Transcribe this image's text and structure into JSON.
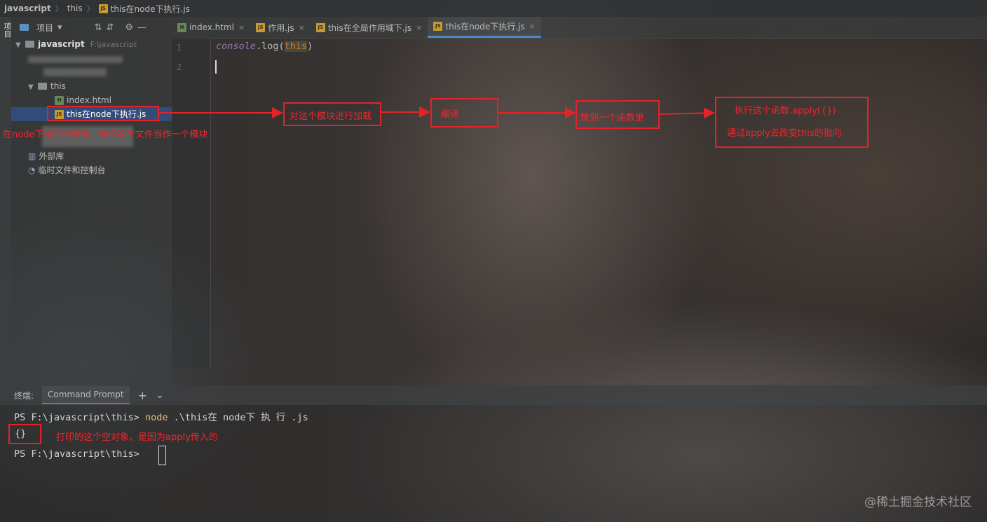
{
  "breadcrumb": {
    "project": "javascript",
    "folder": "this",
    "file": "this在node下执行.js"
  },
  "sidebar_strip": {
    "label": "项目"
  },
  "project_panel": {
    "title": "项目",
    "root_name": "javascript",
    "root_path": "F:\\javascript",
    "folder_this": "this",
    "file_index": "index.html",
    "file_selected": "this在node下执行.js",
    "external_libs": "外部库",
    "scratches": "临时文件和控制台"
  },
  "tabs": [
    {
      "label": "index.html",
      "icon": "html-file-icon"
    },
    {
      "label": "作用.js",
      "icon": "js-file-icon"
    },
    {
      "label": "this在全局作用域下.js",
      "icon": "js-file-icon"
    },
    {
      "label": "this在node下执行.js",
      "icon": "js-file-icon"
    }
  ],
  "editor": {
    "line_numbers": [
      "1",
      "2"
    ],
    "code": {
      "object": "console",
      "dot": ".",
      "method": "log",
      "open": "(",
      "arg": "this",
      "close": ")"
    }
  },
  "terminal": {
    "label": "终端:",
    "tab": "Command Prompt",
    "add": "+",
    "dropdown": "⌄",
    "line1_prompt": "PS F:\\javascript\\this>",
    "line1_cmd": "node",
    "line1_arg": ".\\this在 node下 执 行 .js",
    "output": "{}",
    "line3_prompt": "PS F:\\javascript\\this>"
  },
  "annotations": {
    "load_module": "对这个模块进行加载",
    "compile": "编译",
    "put_in_function": "放到一个函数里",
    "apply_line1": "执行这个函数.apply({})",
    "apply_line2": "通过apply去改变this的指向",
    "node_file_note": "在node下执行的时候，会把这个文件当作一个模块",
    "empty_object_note": "打印的这个空对象，是因为apply传入的"
  },
  "colors": {
    "annotation_red": "#e0242a",
    "active_tab_underline": "#4a88c7",
    "keyword": "#cc7832"
  },
  "watermark": "@稀土掘金技术社区"
}
